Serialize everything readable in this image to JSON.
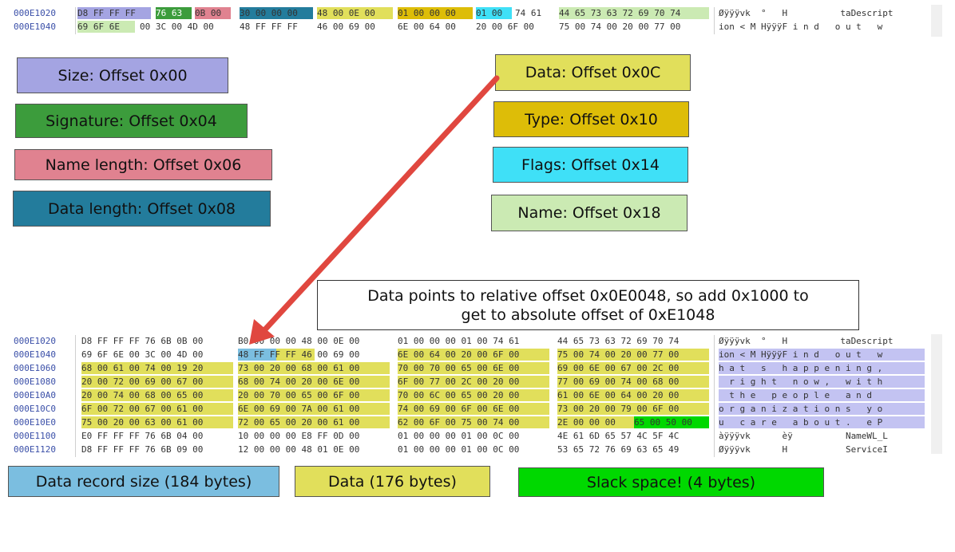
{
  "colors": {
    "size": "#a4a4e2",
    "signature": "#3c9c3c",
    "name_length": "#e08290",
    "data_length": "#237c9c",
    "data": "#e1df5b",
    "type": "#ddbd08",
    "flags": "#3fe0f7",
    "name": "#cbeab3",
    "record_size": "#7bbee0",
    "data_fill": "#e1df5b",
    "slack": "#00d800",
    "ascii_highlight": "#c3c3f2",
    "arrow": "#e0473f"
  },
  "top_dump": [
    {
      "address": "000E1020",
      "groups": [
        "D8 FF FF FF",
        "76 63",
        "0B 00",
        "30 00 00 00",
        "48 00 0E 00",
        "01 00 00 00",
        "01 00",
        "74 61",
        "44 65 73 63 72 69 70 74"
      ],
      "ascii": "Øÿÿÿvk  °   H          taDescript"
    },
    {
      "address": "000E1040",
      "groups": [
        "69 6F 6E",
        "00 3C 00 4D 00",
        "48 FF FF FF",
        "46 00 69 00",
        "6E 00 64 00",
        "20 00 6F 00",
        "75 00 74 00 20 00 77 00"
      ],
      "ascii": "ion < M HÿÿÿF i n d   o u t   w"
    }
  ],
  "labels": {
    "size": "Size: Offset 0x00",
    "signature": "Signature: Offset 0x04",
    "name_length": "Name length: Offset 0x06",
    "data_length": "Data length: Offset 0x08",
    "data": "Data: Offset 0x0C",
    "type": "Type: Offset 0x10",
    "flags": "Flags: Offset 0x14",
    "name": "Name: Offset 0x18"
  },
  "note": {
    "line1": "Data points to relative offset 0x0E0048, so add 0x1000 to",
    "line2": "get to absolute offset of 0xE1048"
  },
  "bottom_dump": [
    {
      "address": "000E1020",
      "g1": "D8 FF FF FF 76 6B 0B 00",
      "g2": "B0 00 00 00 48 00 0E 00",
      "g3": "01 00 00 00 01 00 74 61",
      "g4": "44 65 73 63 72 69 70 74",
      "ascii": "Øÿÿÿvk  °   H          taDescript"
    },
    {
      "address": "000E1040",
      "g1": "69 6F 6E 00 3C 00 4D 00",
      "g2": "48 FF FF FF 46 00 69 00",
      "g3": "6E 00 64 00 20 00 6F 00",
      "g4": "75 00 74 00 20 00 77 00",
      "ascii": "ion < M HÿÿÿF i n d   o u t   w"
    },
    {
      "address": "000E1060",
      "g1": "68 00 61 00 74 00 19 20",
      "g2": "73 00 20 00 68 00 61 00",
      "g3": "70 00 70 00 65 00 6E 00",
      "g4": "69 00 6E 00 67 00 2C 00",
      "ascii": "h a t   s   h a p p e n i n g ,"
    },
    {
      "address": "000E1080",
      "g1": "20 00 72 00 69 00 67 00",
      "g2": "68 00 74 00 20 00 6E 00",
      "g3": "6F 00 77 00 2C 00 20 00",
      "g4": "77 00 69 00 74 00 68 00",
      "ascii": "  r i g h t   n o w ,   w i t h"
    },
    {
      "address": "000E10A0",
      "g1": "20 00 74 00 68 00 65 00",
      "g2": "20 00 70 00 65 00 6F 00",
      "g3": "70 00 6C 00 65 00 20 00",
      "g4": "61 00 6E 00 64 00 20 00",
      "ascii": "  t h e   p e o p l e   a n d  "
    },
    {
      "address": "000E10C0",
      "g1": "6F 00 72 00 67 00 61 00",
      "g2": "6E 00 69 00 7A 00 61 00",
      "g3": "74 00 69 00 6F 00 6E 00",
      "g4": "73 00 20 00 79 00 6F 00",
      "ascii": "o r g a n i z a t i o n s   y o"
    },
    {
      "address": "000E10E0",
      "g1": "75 00 20 00 63 00 61 00",
      "g2": "72 00 65 00 20 00 61 00",
      "g3": "62 00 6F 00 75 00 74 00",
      "g4a": "2E 00 00 00",
      "g4b": "65 00 50 00",
      "ascii": "u   c a r e   a b o u t .   e P"
    },
    {
      "address": "000E1100",
      "g1": "E0 FF FF FF 76 6B 04 00",
      "g2": "10 00 00 00 E8 FF 0D 00",
      "g3": "01 00 00 00 01 00 0C 00",
      "g4": "4E 61 6D 65 57 4C 5F 4C",
      "ascii": "àÿÿÿvk      èÿ          NameWL_L"
    },
    {
      "address": "000E1120",
      "g1": "D8 FF FF FF 76 6B 09 00",
      "g2": "12 00 00 00 48 01 0E 00",
      "g3": "01 00 00 00 01 00 0C 00",
      "g4": "53 65 72 76 69 63 65 49",
      "ascii": "Øÿÿÿvk      H           ServiceI"
    }
  ],
  "legend": {
    "record_size": "Data record size (184 bytes)",
    "data": "Data (176 bytes)",
    "slack": "Slack space! (4 bytes)"
  }
}
